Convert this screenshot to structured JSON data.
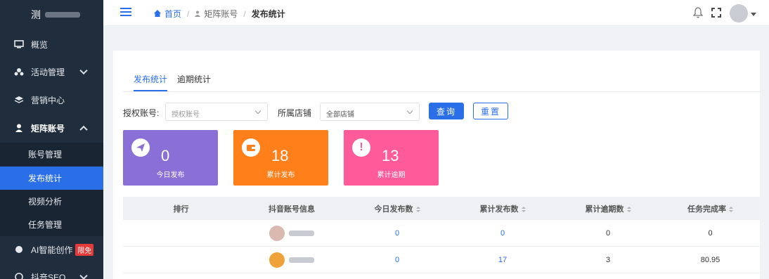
{
  "sidebar": {
    "brand_initial": "测",
    "items": [
      {
        "label": "概览",
        "icon": "monitor-icon"
      },
      {
        "label": "活动管理",
        "icon": "activity-icon"
      },
      {
        "label": "营销中心",
        "icon": "layers-icon"
      },
      {
        "label": "矩阵账号",
        "icon": "user-icon"
      },
      {
        "label": "AI智能创作",
        "icon": "ai-icon",
        "badge": "限免"
      },
      {
        "label": "抖音SEO",
        "icon": "seo-icon"
      }
    ],
    "sub_items": [
      {
        "label": "账号管理"
      },
      {
        "label": "发布统计",
        "active": true
      },
      {
        "label": "视频分析"
      },
      {
        "label": "任务管理"
      }
    ]
  },
  "breadcrumb": {
    "home": "首页",
    "parent": "矩阵账号",
    "current": "发布统计"
  },
  "tabs": [
    {
      "label": "发布统计",
      "active": true
    },
    {
      "label": "逾期统计",
      "active": false
    }
  ],
  "filters": {
    "account_label": "授权账号:",
    "account_placeholder": "授权账号",
    "store_label": "所属店铺",
    "store_value": "全部店铺",
    "query_button": "查询",
    "reset_button": "重置"
  },
  "stats": [
    {
      "value": "0",
      "label": "今日发布",
      "color": "#8a6fd6",
      "icon": "paper-plane-icon"
    },
    {
      "value": "18",
      "label": "累计发布",
      "color": "#ff7f1a",
      "icon": "wallet-icon"
    },
    {
      "value": "13",
      "label": "累计逾期",
      "color": "#ff5a9a",
      "icon": "alert-icon"
    }
  ],
  "table": {
    "headers": [
      "排行",
      "抖音账号信息",
      "今日发布数",
      "累计发布数",
      "累计逾期数",
      "任务完成率"
    ],
    "rows": [
      {
        "rank": "",
        "today": "0",
        "total": "0",
        "overdue": "0",
        "rate": "0"
      },
      {
        "rank": "",
        "today": "0",
        "total": "17",
        "overdue": "3",
        "rate": "80.95"
      }
    ]
  },
  "colors": {
    "accent": "#2a6fe8",
    "sidebar": "#1f2d3d"
  }
}
